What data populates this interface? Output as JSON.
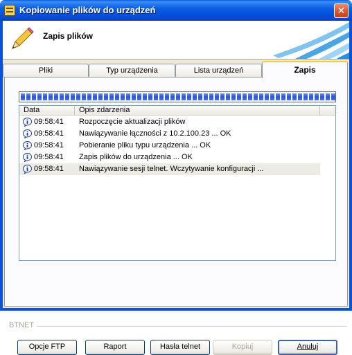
{
  "window": {
    "title": "Kopiowanie plików do urządzeń",
    "close_label": "✕"
  },
  "header": {
    "title": "Zapis plików"
  },
  "tabs": [
    {
      "label": "Pliki"
    },
    {
      "label": "Typ urządzenia"
    },
    {
      "label": "Lista urządzeń"
    },
    {
      "label": "Zapis"
    }
  ],
  "progress": {
    "segments": 57,
    "value_percent": 100
  },
  "log": {
    "columns": [
      "Data",
      "Opis zdarzenia"
    ],
    "rows": [
      {
        "time": "09:58:41",
        "message": "Rozpoczęcie aktualizacji plików",
        "icon": "info-icon"
      },
      {
        "time": "09:58:41",
        "message": "Nawiązywanie łączności z 10.2.100.23 ... OK",
        "icon": "info-icon"
      },
      {
        "time": "09:58:41",
        "message": "Pobieranie pliku typu urządzenia ... OK",
        "icon": "info-icon"
      },
      {
        "time": "09:58:41",
        "message": "Zapis plików do urządzenia ... OK",
        "icon": "info-icon"
      },
      {
        "time": "09:58:41",
        "message": "Nawiązywanie sesji telnet. Wczytywanie konfiguracji ...",
        "icon": "info-icon"
      }
    ]
  },
  "footer": {
    "brand": "BTNET"
  },
  "buttons": {
    "ftp": "Opcje FTP",
    "report": "Raport",
    "telnet_password": "Hasła telnet",
    "copy": "Kopiuj",
    "cancel": "Anuluj"
  },
  "colors": {
    "title_bar": "#0a52d9",
    "progress": "#2a55d8",
    "active_tab_accent": "#ffc83c"
  }
}
